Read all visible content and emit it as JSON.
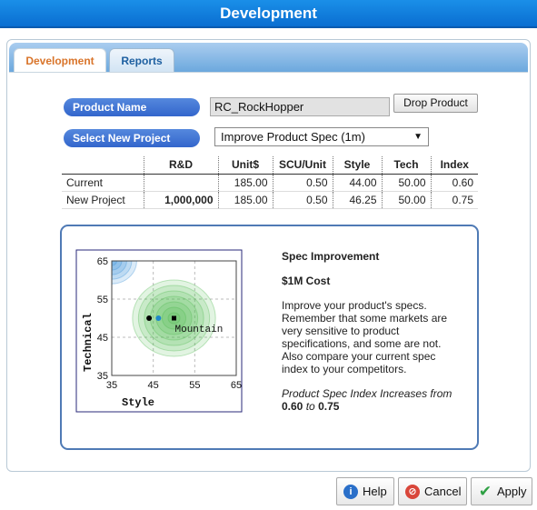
{
  "window": {
    "title": "Development"
  },
  "tabs": [
    {
      "label": "Development",
      "active": true
    },
    {
      "label": "Reports",
      "active": false
    }
  ],
  "product": {
    "name_label": "Product Name",
    "name_value": "RC_RockHopper",
    "drop_button": "Drop Product"
  },
  "project": {
    "select_label": "Select New Project",
    "selected": "Improve Product Spec (1m)"
  },
  "spec_table": {
    "headers": [
      "",
      "R&D",
      "Unit$",
      "SCU/Unit",
      "Style",
      "Tech",
      "Index"
    ],
    "rows": [
      [
        "Current",
        "",
        "185.00",
        "0.50",
        "44.00",
        "50.00",
        "0.60"
      ],
      [
        "New Project",
        "1,000,000",
        "185.00",
        "0.50",
        "46.25",
        "50.00",
        "0.75"
      ]
    ]
  },
  "info": {
    "title": "Spec Improvement",
    "cost": "$1M Cost",
    "description": "Improve your product's specs. Remember that some markets are very sensitive to product specifications, and some are not. Also compare your current spec index to your competitors.",
    "increase_prefix": "Product Spec Index Increases from",
    "from_value": "0.60",
    "to_word": "to",
    "to_value": "0.75"
  },
  "chart_data": {
    "type": "scatter",
    "xlabel": "Style",
    "ylabel": "Technical",
    "xlim": [
      35,
      65
    ],
    "ylim": [
      35,
      65
    ],
    "x_ticks": [
      "35",
      "45",
      "55",
      "65"
    ],
    "y_ticks": [
      "35",
      "45",
      "55",
      "65"
    ],
    "grid": true,
    "points": [
      {
        "name": "current",
        "x": 44,
        "y": 50,
        "color": "#000000",
        "shape": "circle"
      },
      {
        "name": "new",
        "x": 46.25,
        "y": 50,
        "color": "#1e88c8",
        "shape": "circle"
      },
      {
        "name": "mountain-ideal",
        "x": 50,
        "y": 50,
        "color": "#000000",
        "shape": "square"
      }
    ],
    "region_label": "Mountain",
    "region": {
      "center": [
        50,
        50
      ],
      "radius": 10,
      "color": "#4cb84c"
    },
    "other_region": {
      "center": [
        35,
        65
      ],
      "radius": 6,
      "color": "#3a8fd6"
    }
  },
  "footer": {
    "help": "Help",
    "cancel": "Cancel",
    "apply": "Apply"
  },
  "colors": {
    "title_bar": "#0a6ed1",
    "pill": "#3366cc",
    "active_tab_text": "#d9742a",
    "info_border": "#4f7ab5"
  }
}
